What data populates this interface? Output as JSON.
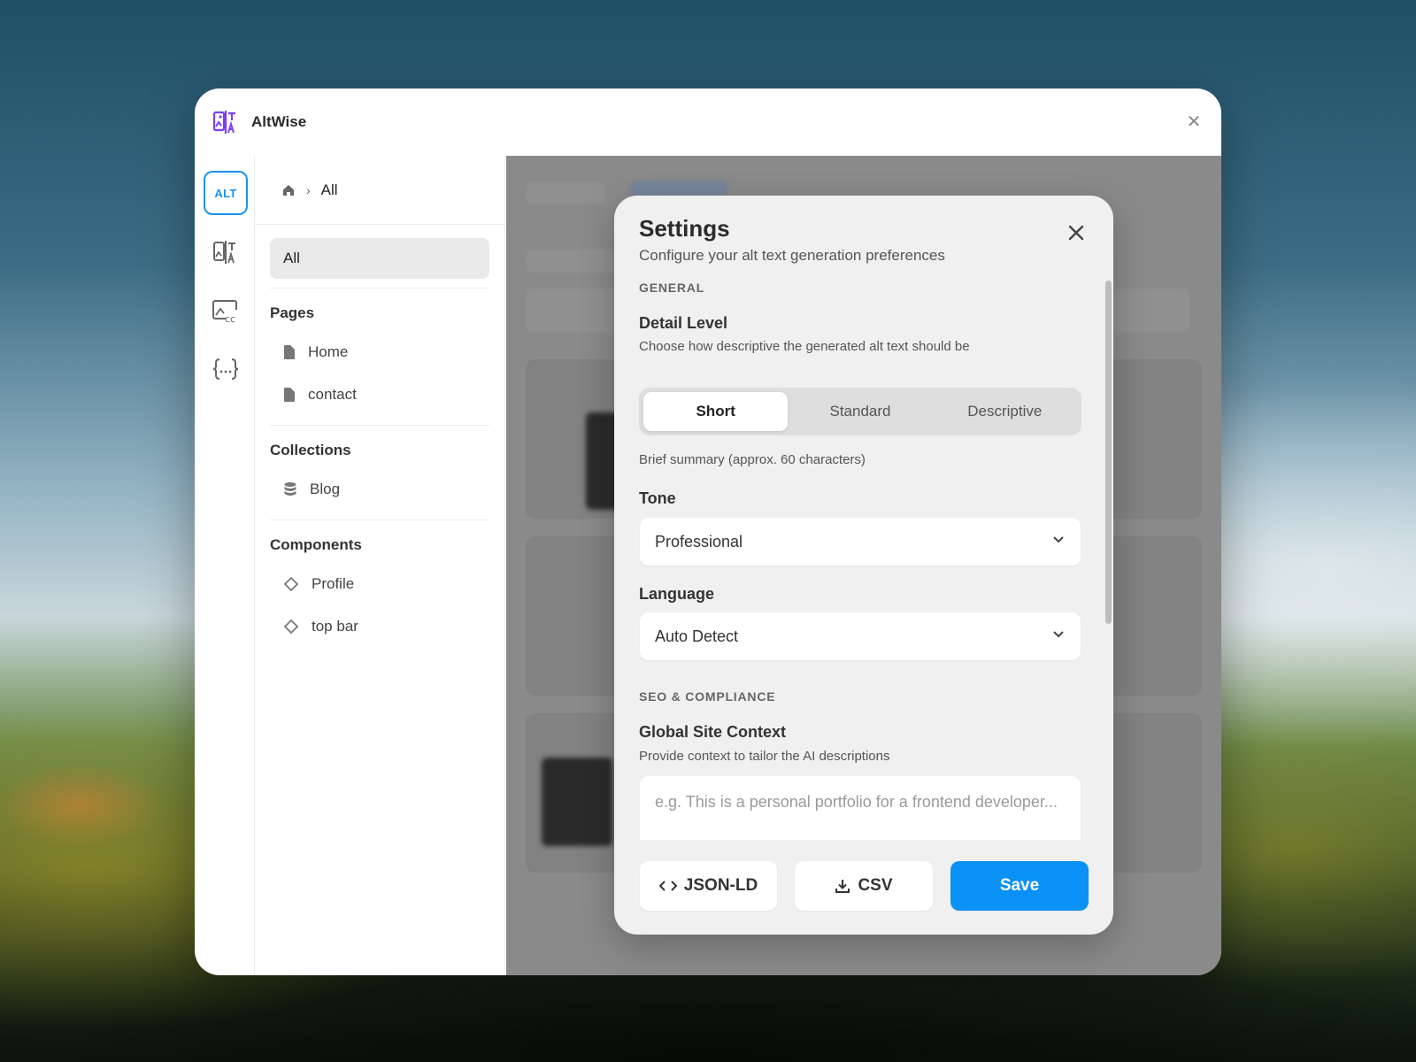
{
  "app": {
    "title": "AltWise"
  },
  "rail": {
    "alt_badge": "ALT"
  },
  "breadcrumb": {
    "current": "All"
  },
  "sidebar": {
    "all_label": "All",
    "groups": [
      {
        "title": "Pages",
        "items": [
          "Home",
          "contact"
        ]
      },
      {
        "title": "Collections",
        "items": [
          "Blog"
        ]
      },
      {
        "title": "Components",
        "items": [
          "Profile",
          "top bar"
        ]
      }
    ]
  },
  "modal": {
    "title": "Settings",
    "subtitle": "Configure your alt text generation preferences",
    "general_heading": "GENERAL",
    "detail_level": {
      "title": "Detail Level",
      "desc": "Choose how descriptive the generated alt text should be",
      "options": [
        "Short",
        "Standard",
        "Descriptive"
      ],
      "selected": "Short",
      "hint": "Brief summary (approx. 60 characters)"
    },
    "tone": {
      "title": "Tone",
      "value": "Professional"
    },
    "language": {
      "title": "Language",
      "value": "Auto Detect"
    },
    "seo_heading": "SEO & COMPLIANCE",
    "global_context": {
      "title": "Global Site Context",
      "desc": "Provide context to tailor the AI descriptions",
      "placeholder": "e.g. This is a personal portfolio for a frontend developer..."
    },
    "buttons": {
      "json_ld": "JSON-LD",
      "csv": "CSV",
      "save": "Save"
    }
  },
  "colors": {
    "accent": "#0a91f5",
    "logo": "#7b3ff2"
  }
}
